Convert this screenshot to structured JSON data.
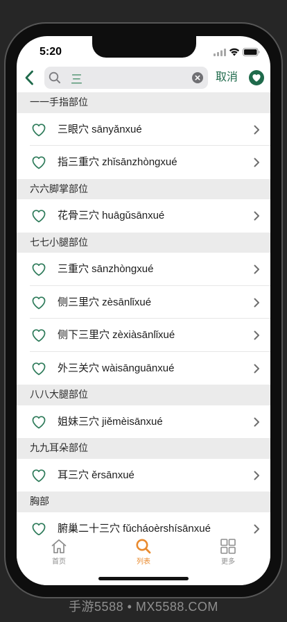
{
  "status_bar": {
    "time": "5:20",
    "icons": [
      "signal-icon",
      "wifi-icon",
      "battery-icon"
    ]
  },
  "header": {
    "back_icon": "chevron-left-icon",
    "search_icon": "search-icon",
    "search_query": "三",
    "clear_icon": "clear-icon",
    "cancel_label": "取消",
    "favorites_icon": "heart-circle-icon"
  },
  "sections": [
    {
      "title": "一一手指部位",
      "items": [
        {
          "label": "三眼穴 sānyǎnxué"
        },
        {
          "label": "指三重穴 zhǐsānzhòngxué"
        }
      ]
    },
    {
      "title": "六六脚掌部位",
      "items": [
        {
          "label": "花骨三穴 huāgǔsānxué"
        }
      ]
    },
    {
      "title": "七七小腿部位",
      "items": [
        {
          "label": "三重穴 sānzhòngxué"
        },
        {
          "label": "侧三里穴 zèsānlǐxué"
        },
        {
          "label": "侧下三里穴 zèxiàsānlǐxué"
        },
        {
          "label": "外三关穴 wàisānguānxué"
        }
      ]
    },
    {
      "title": "八八大腿部位",
      "items": [
        {
          "label": "姐妹三穴 jiěmèisānxué"
        }
      ]
    },
    {
      "title": "九九耳朵部位",
      "items": [
        {
          "label": "耳三穴 ěrsānxué"
        }
      ]
    },
    {
      "title": "胸部",
      "items": [
        {
          "label": "腑巢二十三穴 fǔcháoèrshísānxué"
        }
      ]
    }
  ],
  "item_icons": {
    "favorite": "heart-outline-icon",
    "disclosure": "chevron-right-icon"
  },
  "tab_bar": {
    "tabs": [
      {
        "label": "首页",
        "icon": "home-icon",
        "active": false
      },
      {
        "label": "列表",
        "icon": "search-icon",
        "active": true
      },
      {
        "label": "更多",
        "icon": "grid-icon",
        "active": false
      }
    ]
  },
  "watermark": "手游5588 • MX5588.COM",
  "colors": {
    "accent": "#1f6a4b",
    "heart_outline": "#2e7b5a",
    "search_text": "#3d8a62",
    "tab_active": "#e98a2e",
    "tab_inactive": "#8e8e8e",
    "section_header_bg": "#ebebeb",
    "screen_bg": "#ffffff",
    "device_bg": "#262626"
  }
}
